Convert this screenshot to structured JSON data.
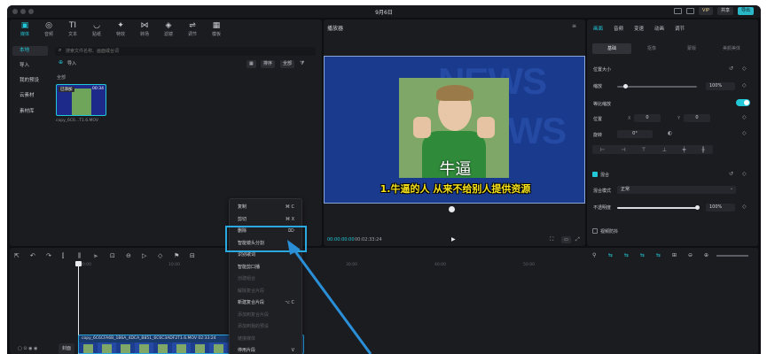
{
  "window": {
    "title": "9月6日"
  },
  "titlebar": {
    "vip": "VIP",
    "share": "共享",
    "export": "导出"
  },
  "toolbar": {
    "tools": [
      {
        "label": "媒体",
        "icon": "media-icon"
      },
      {
        "label": "音频",
        "icon": "audio-icon"
      },
      {
        "label": "文本",
        "icon": "text-icon",
        "glyph": "TI"
      },
      {
        "label": "贴纸",
        "icon": "sticker-icon"
      },
      {
        "label": "特效",
        "icon": "effects-icon"
      },
      {
        "label": "转场",
        "icon": "transition-icon"
      },
      {
        "label": "滤镜",
        "icon": "filter-icon"
      },
      {
        "label": "调节",
        "icon": "adjust-icon"
      },
      {
        "label": "模板",
        "icon": "template-icon"
      }
    ]
  },
  "media": {
    "sidebar": [
      "本地",
      "导入",
      "我的预设",
      "云素材",
      "素材库"
    ],
    "search_placeholder": "搜索文件名称、画面或台词",
    "import_label": "导入",
    "filter_all": "全部",
    "sort_label": "排序",
    "all_label": "全部",
    "clip": {
      "badge": "已添加",
      "duration": "00:34",
      "name": "copy_6C6...T1.6.MOV"
    }
  },
  "player": {
    "title": "播放器",
    "subtitle_main": "牛逼",
    "subtitle_sub": "1.牛逼的人 从来不给别人提供资源",
    "bg_text": "NEWS",
    "current_time": "00:00:00:00",
    "total_time": "00:02:33:24"
  },
  "properties": {
    "tabs": [
      "画面",
      "音频",
      "变速",
      "动画",
      "调节"
    ],
    "subtabs": [
      "基础",
      "抠像",
      "蒙版",
      "美颜美体"
    ],
    "position_size": "位置大小",
    "scale_label": "缩放",
    "scale_value": "100%",
    "ratio_label": "等比缩放",
    "position_label": "位置",
    "pos_x_label": "X",
    "pos_x": "0",
    "pos_y_label": "Y",
    "pos_y": "0",
    "rotate_label": "旋转",
    "rotate_value": "0°",
    "blend_label": "混合",
    "blend_mode_label": "混合模式",
    "blend_mode_value": "正常",
    "opacity_label": "不透明度",
    "opacity_value": "100%",
    "stabilize_label": "视频防抖",
    "scale_level": 0.1,
    "opacity_level": 1.0
  },
  "context_menu": {
    "items": [
      {
        "label": "复制",
        "shortcut": "⌘ C",
        "enabled": true
      },
      {
        "label": "剪切",
        "shortcut": "⌘ X",
        "enabled": true
      },
      {
        "label": "删除",
        "shortcut": "⌦",
        "enabled": true
      },
      {
        "label": "智能镜头分割",
        "shortcut": "",
        "enabled": true,
        "highlight": true
      },
      {
        "label": "识别歌词",
        "shortcut": "",
        "enabled": true
      },
      {
        "label": "智能剪口播",
        "shortcut": "",
        "enabled": true
      },
      {
        "label": "创建组合",
        "shortcut": "",
        "enabled": false
      },
      {
        "label": "解除复合片段",
        "shortcut": "",
        "enabled": false
      },
      {
        "label": "新建复合片段",
        "shortcut": "⌥ C",
        "enabled": true
      },
      {
        "label": "添加到复合片段",
        "shortcut": "",
        "enabled": false
      },
      {
        "label": "添加到我的预设",
        "shortcut": "",
        "enabled": false
      },
      {
        "label": "链接媒体",
        "shortcut": "",
        "enabled": false
      },
      {
        "label": "停用片段",
        "shortcut": "V",
        "enabled": true
      }
    ]
  },
  "timeline": {
    "ticks": [
      "00:00",
      "10:00",
      "20:00",
      "30:00",
      "40:00",
      "50:00"
    ],
    "cover_label": "封面",
    "clip_name": "copy_6C6CFA6B_1B6A_4DCA_B851_6C6C3ADF2T1.6.MOV  02:33:24"
  },
  "colors": {
    "accent": "#22c8d8",
    "highlight_box": "#2aa8e0",
    "arrow": "#2a8fd6",
    "subtitle_yellow": "#f7e21a"
  }
}
